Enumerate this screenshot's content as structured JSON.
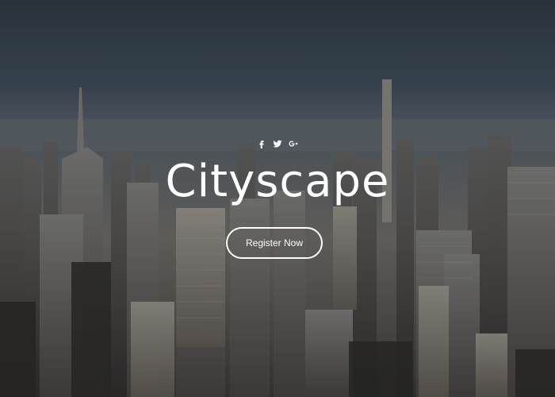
{
  "hero": {
    "title": "Cityscape",
    "cta_label": "Register Now"
  },
  "social": [
    {
      "name": "facebook-icon"
    },
    {
      "name": "twitter-icon"
    },
    {
      "name": "google-plus-icon"
    }
  ],
  "colors": {
    "text": "#ffffff",
    "button_border": "#ffffff"
  }
}
